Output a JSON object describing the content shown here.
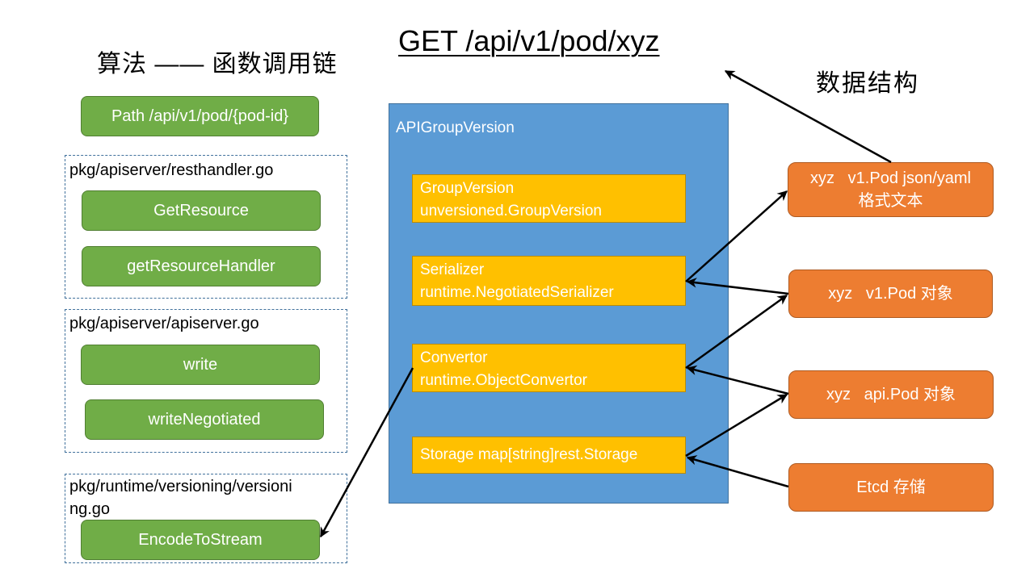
{
  "title": "GET /api/v1/pod/xyz",
  "left_heading": "算法 —— 函数调用链",
  "right_heading": "数据结构",
  "path_box": "Path /api/v1/pod/{pod-id}",
  "groups": [
    {
      "label": "pkg/apiserver/resthandler.go",
      "functions": [
        "GetResource",
        "getResourceHandler"
      ]
    },
    {
      "label": "pkg/apiserver/apiserver.go",
      "functions": [
        "write",
        "writeNegotiated"
      ]
    },
    {
      "label_line1": "pkg/runtime/versioning/versioni",
      "label_line2": "ng.go",
      "functions": [
        "EncodeToStream"
      ]
    }
  ],
  "api_group_version": {
    "label": "APIGroupVersion",
    "fields": [
      {
        "name": "GroupVersion",
        "type": "unversioned.GroupVersion"
      },
      {
        "name": "Serializer",
        "type": "runtime.NegotiatedSerializer"
      },
      {
        "name": "Convertor",
        "type": "runtime.ObjectConvertor"
      },
      {
        "name": "Storage map[string]rest.Storage",
        "type": ""
      }
    ]
  },
  "data_structures": [
    {
      "line1": "xyz   v1.Pod json/yaml",
      "line2": "格式文本"
    },
    {
      "line1": "xyz   v1.Pod 对象"
    },
    {
      "line1": "xyz   api.Pod 对象"
    },
    {
      "line1": "Etcd 存储"
    }
  ],
  "colors": {
    "function_green": "#70ad47",
    "container_blue": "#5b9bd5",
    "field_yellow": "#ffc000",
    "data_orange": "#ed7d31",
    "group_border": "#41719c"
  },
  "arrows": [
    {
      "from": "Etcd 存储",
      "to": "Storage"
    },
    {
      "from": "Storage",
      "to": "xyz api.Pod 对象"
    },
    {
      "from": "xyz api.Pod 对象",
      "to": "Convertor"
    },
    {
      "from": "Convertor",
      "to": "xyz v1.Pod 对象"
    },
    {
      "from": "xyz v1.Pod 对象",
      "to": "Serializer"
    },
    {
      "from": "Serializer",
      "to": "xyz v1.Pod json/yaml 格式文本"
    },
    {
      "from": "xyz v1.Pod json/yaml 格式文本",
      "to": "GET /api/v1/pod/xyz"
    },
    {
      "from": "Convertor",
      "to": "EncodeToStream"
    }
  ]
}
